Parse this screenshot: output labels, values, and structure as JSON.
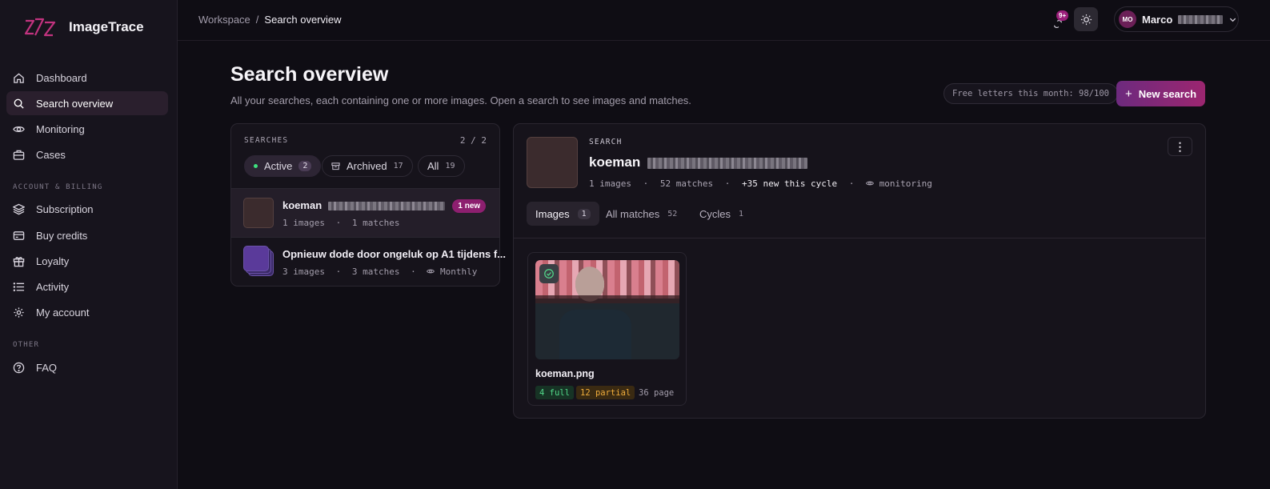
{
  "app": {
    "name": "ImageTrace"
  },
  "sidebar": {
    "items": [
      {
        "label": "Dashboard",
        "icon": "home-icon"
      },
      {
        "label": "Search overview",
        "icon": "search-icon",
        "active": true
      },
      {
        "label": "Monitoring",
        "icon": "eye-icon"
      },
      {
        "label": "Cases",
        "icon": "briefcase-icon"
      }
    ],
    "section_billing": "ACCOUNT & BILLING",
    "billing_items": [
      {
        "label": "Subscription",
        "icon": "layers-icon"
      },
      {
        "label": "Buy credits",
        "icon": "credit-card-icon"
      },
      {
        "label": "Loyalty",
        "icon": "gift-icon"
      },
      {
        "label": "Activity",
        "icon": "list-icon"
      },
      {
        "label": "My account",
        "icon": "gear-icon"
      }
    ],
    "section_other": "OTHER",
    "other_items": [
      {
        "label": "FAQ",
        "icon": "help-circle-icon"
      }
    ]
  },
  "topbar": {
    "breadcrumb": {
      "root": "Workspace",
      "separator": "/",
      "current": "Search overview"
    },
    "notifications_badge": "9+",
    "user": {
      "initials": "MO",
      "name": "Marco"
    }
  },
  "header": {
    "title": "Search overview",
    "subtitle": "All your searches, each containing one or more images. Open a search to see images and matches.",
    "free_letters": "Free letters this month: 98/100",
    "new_search_label": "New search"
  },
  "searches": {
    "label": "SEARCHES",
    "count": "2 / 2",
    "filters": [
      {
        "label": "Active",
        "count": "2",
        "active": true
      },
      {
        "label": "Archived",
        "count": "17"
      },
      {
        "label": "All",
        "count": "19"
      }
    ],
    "rows": [
      {
        "title": "koeman",
        "badge": "1 new",
        "images": "1 images",
        "matches": "1 matches",
        "selected": true
      },
      {
        "title": "Opnieuw dode door ongeluk op A1 tijdens f...",
        "images": "3 images",
        "matches": "3 matches",
        "monitor": "Monthly"
      }
    ]
  },
  "detail": {
    "label": "SEARCH",
    "title": "koeman",
    "meta": {
      "images": "1 images",
      "matches": "52 matches",
      "new": "+35 new this cycle",
      "monitor": "monitoring"
    },
    "tabs": [
      {
        "label": "Images",
        "count": "1",
        "active": true
      },
      {
        "label": "All matches",
        "count": "52"
      },
      {
        "label": "Cycles",
        "count": "1"
      }
    ],
    "image_card": {
      "filename": "koeman.png",
      "full": "4 full",
      "partial": "12 partial",
      "page": "36 page"
    }
  },
  "colors": {
    "accent": "#9c2670",
    "background": "#0f0d14",
    "success": "#52d98a",
    "warning": "#f0ad3c"
  }
}
